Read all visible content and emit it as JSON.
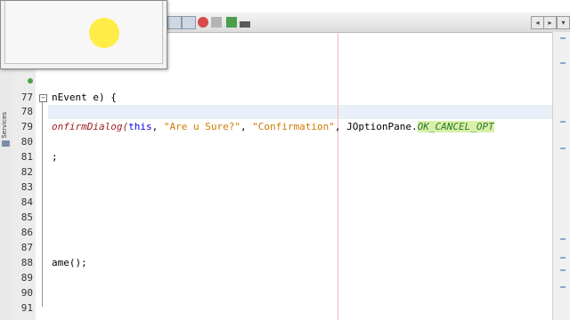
{
  "toolbar": {
    "icons": [
      "nav-back-icon",
      "nav-forward-icon",
      "stop-icon",
      "pause-icon",
      "run-icon",
      "step-icon"
    ],
    "right_icons": [
      "previous-icon",
      "next-icon",
      "maximize-icon"
    ]
  },
  "sidebar": {
    "services_label": "Services"
  },
  "gutter": {
    "line_numbers": [
      "77",
      "78",
      "79",
      "80",
      "81",
      "82",
      "83",
      "84",
      "85",
      "86",
      "87",
      "88",
      "89",
      "90",
      "91"
    ]
  },
  "code": {
    "line77": "nEvent e) {",
    "line79_method": "onfirmDialog(",
    "line79_this": "this",
    "line79_sep1": ", ",
    "line79_str1": "\"Are u Sure?\"",
    "line79_sep2": ", ",
    "line79_str2": "\"Confirmation\"",
    "line79_sep3": ", JOptionPane.",
    "line79_const": "OK_CANCEL_OPT",
    "line81": ";",
    "line88": "ame();"
  },
  "colors": {
    "accent": "#e9eff8",
    "string": "#ce7b00",
    "keyword": "#0000e6",
    "constant_highlight": "#d9f0a8",
    "cursor_highlight": "#ffeb28"
  }
}
